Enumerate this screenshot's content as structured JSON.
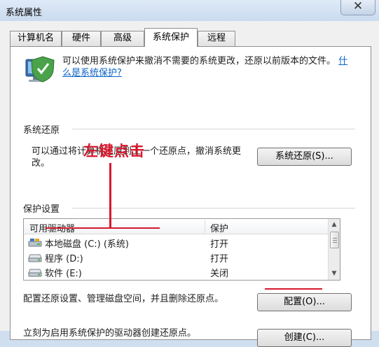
{
  "window": {
    "title": "系统属性",
    "close_glyph": "✕"
  },
  "tabs": [
    {
      "label": "计算机名"
    },
    {
      "label": "硬件"
    },
    {
      "label": "高级"
    },
    {
      "label": "系统保护"
    },
    {
      "label": "远程"
    }
  ],
  "intro": {
    "text": "可以使用系统保护来撤消不需要的系统更改，还原以前版本的文件。",
    "link": "什么是系统保护?"
  },
  "restore": {
    "title": "系统还原",
    "description": "可以通过将计算机还原到上一个还原点，撤消系统更改。",
    "button": "系统还原(S)..."
  },
  "protection": {
    "title": "保护设置",
    "columns": [
      "可用驱动器",
      "保护"
    ],
    "drives": [
      {
        "name": "本地磁盘 (C:) (系统)",
        "status": "打开",
        "icon": "system-drive-icon"
      },
      {
        "name": "程序 (D:)",
        "status": "打开",
        "icon": "hard-drive-icon"
      },
      {
        "name": "软件 (E:)",
        "status": "关闭",
        "icon": "hard-drive-icon"
      }
    ],
    "configure_description": "配置还原设置、管理磁盘空间，并且删除还原点。",
    "configure_button": "配置(O)...",
    "create_description": "立刻为启用系统保护的驱动器创建还原点。",
    "create_button": "创建(C)..."
  },
  "annotation": {
    "text": "左键点击",
    "color": "#d8182d"
  },
  "colors": {
    "link": "#0b63c6",
    "window_frame": "#cfdff0",
    "panel": "#ffffff"
  }
}
